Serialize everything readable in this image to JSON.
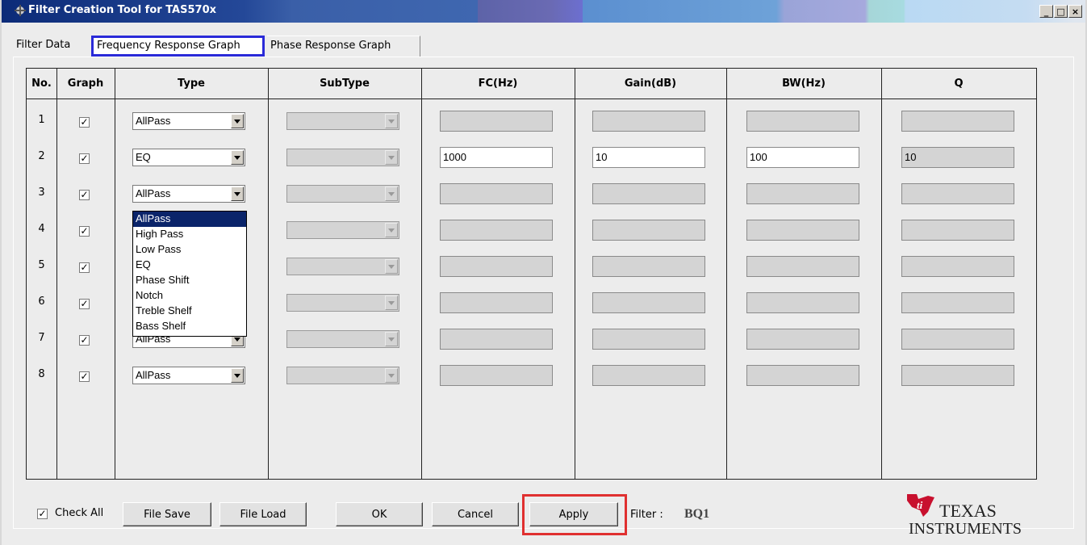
{
  "window": {
    "title": "Filter Creation Tool for TAS570x",
    "btn_min": "_",
    "btn_max": "□",
    "btn_close": "×"
  },
  "tabs": [
    {
      "label": "Filter Data"
    },
    {
      "label": "Frequency Response Graph"
    },
    {
      "label": "Phase Response Graph"
    }
  ],
  "columns": [
    "No.",
    "Graph",
    "Type",
    "SubType",
    "FC(Hz)",
    "Gain(dB)",
    "BW(Hz)",
    "Q"
  ],
  "rows": [
    {
      "no": "1",
      "type": "AllPass",
      "fc": "",
      "gain": "",
      "bw": "",
      "q": ""
    },
    {
      "no": "2",
      "type": "EQ",
      "fc": "1000",
      "gain": "10",
      "bw": "100",
      "q": "10"
    },
    {
      "no": "3",
      "type": "AllPass",
      "fc": "",
      "gain": "",
      "bw": "",
      "q": ""
    },
    {
      "no": "4",
      "type": "",
      "fc": "",
      "gain": "",
      "bw": "",
      "q": ""
    },
    {
      "no": "5",
      "type": "",
      "fc": "",
      "gain": "",
      "bw": "",
      "q": ""
    },
    {
      "no": "6",
      "type": "",
      "fc": "",
      "gain": "",
      "bw": "",
      "q": ""
    },
    {
      "no": "7",
      "type": "AllPass",
      "fc": "",
      "gain": "",
      "bw": "",
      "q": ""
    },
    {
      "no": "8",
      "type": "AllPass",
      "fc": "",
      "gain": "",
      "bw": "",
      "q": ""
    }
  ],
  "dropdown_options": [
    "AllPass",
    "High Pass",
    "Low Pass",
    "EQ",
    "Phase Shift",
    "Notch",
    "Treble Shelf",
    "Bass Shelf"
  ],
  "footer": {
    "check_all": "Check All",
    "file_save": "File Save",
    "file_load": "File Load",
    "ok": "OK",
    "cancel": "Cancel",
    "apply": "Apply",
    "filter_label": "Filter :",
    "filter_value": "BQ1"
  },
  "logo": {
    "line1": "TEXAS",
    "line2": "INSTRUMENTS"
  },
  "colors": {
    "highlight_box": "#e03030",
    "tab_highlight": "#2a2ad8",
    "selected_option": "#0a246a"
  }
}
